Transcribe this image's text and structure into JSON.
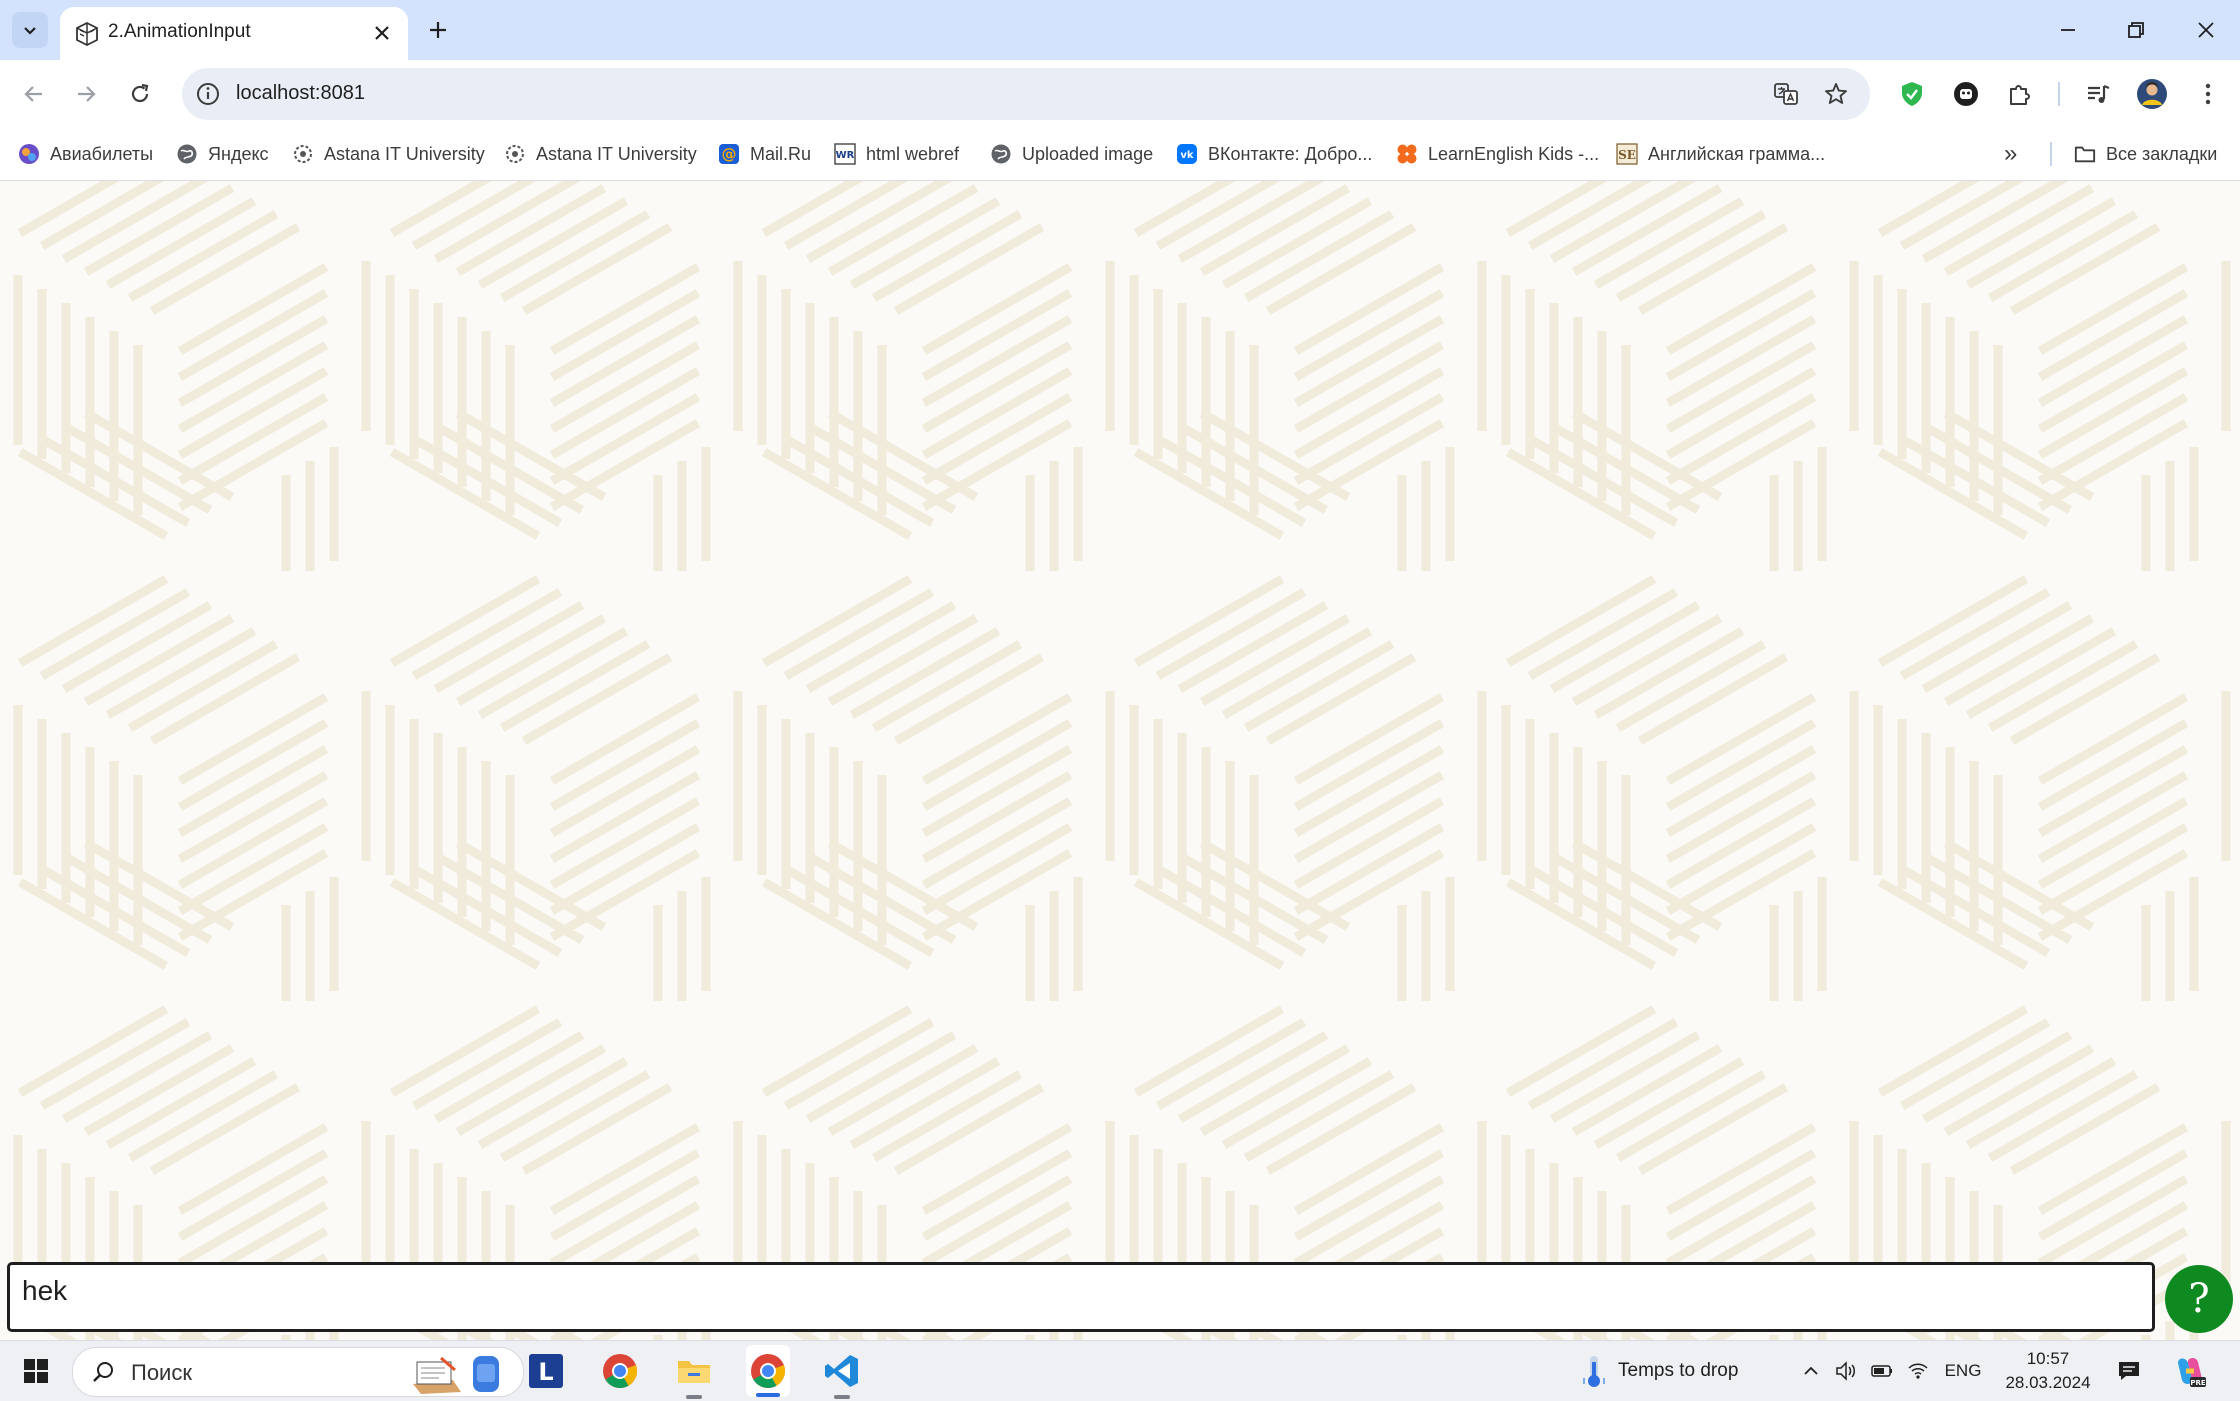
{
  "browser": {
    "tab_title": "2.AnimationInput",
    "url": "localhost:8081"
  },
  "bookmarks": [
    {
      "label": "Авиабилеты",
      "icon": "aviasales-icon"
    },
    {
      "label": "Яндекс",
      "icon": "globe-icon"
    },
    {
      "label": "Astana IT University",
      "icon": "astana-it-icon"
    },
    {
      "label": "Astana IT University",
      "icon": "astana-it-icon"
    },
    {
      "label": "Mail.Ru",
      "icon": "mailru-icon"
    },
    {
      "label": "html webref",
      "icon": "webref-icon"
    },
    {
      "label": "Uploaded image",
      "icon": "globe-icon"
    },
    {
      "label": "ВКонтакте: Добро...",
      "icon": "vk-icon"
    },
    {
      "label": "LearnEnglish Kids -...",
      "icon": "learnenglish-icon"
    },
    {
      "label": "Английская грамма...",
      "icon": "se-icon"
    }
  ],
  "bookmarks_more": "»",
  "all_bookmarks": "Все закладки",
  "page": {
    "input_value": "hek",
    "help_label": "?"
  },
  "taskbar": {
    "search_placeholder": "Поиск",
    "weather": "Temps to drop",
    "language": "ENG",
    "time": "10:57",
    "date": "28.03.2024"
  },
  "colors": {
    "tabstrip": "#d3e3fd",
    "pattern_bg": "#fbfaf6",
    "pattern_line": "#efe8d6",
    "help_button": "#0f8a21"
  }
}
